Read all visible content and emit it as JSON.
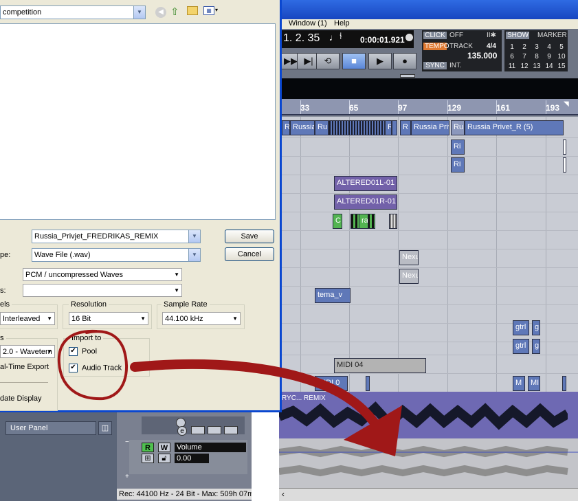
{
  "dialog": {
    "folder_value": "competition",
    "filename_label": "",
    "filename_value": "Russia_Privjet_FREDRIKAS_REMIX",
    "filetype_label": "pe:",
    "filetype_value": "Wave File (.wav)",
    "coding_value": "PCM / uncompressed Waves",
    "attr_label": "s:",
    "attr_value": "",
    "save_label": "Save",
    "cancel_label": "Cancel",
    "channels_label": "els",
    "channels_value": "Interleaved",
    "resolution_label": "Resolution",
    "resolution_value": "16 Bit",
    "samplerate_label": "Sample Rate",
    "samplerate_value": "44.100 kHz",
    "outputs_label": "s",
    "outputs_value": "2.0 - Wavetern",
    "realtime_label": "al-Time Export",
    "update_label": "date Display",
    "import_to_label": "Import to",
    "pool_label": "Pool",
    "audio_track_label": "Audio Track",
    "pool_checked": true,
    "audio_track_checked": true
  },
  "daw": {
    "menu_window": "Window (1)",
    "menu_help": "Help",
    "position_bars": "1. 2. 35",
    "position_time": "0:00:01.921",
    "click_label": "CLICK",
    "click_value": "OFF",
    "tempo_label": "TEMPO",
    "track_label": "TRACK",
    "signature": "4/4",
    "tempo_value": "135.000",
    "sync_label": "SYNC",
    "sync_value": "INT.",
    "show_label": "SHOW",
    "marker_label": "MARKER",
    "marker_numbers": [
      "1",
      "2",
      "3",
      "4",
      "5",
      "6",
      "7",
      "8",
      "9",
      "10",
      "11",
      "12",
      "13",
      "14",
      "15"
    ],
    "ruler": [
      "33",
      "65",
      "97",
      "129",
      "161",
      "193"
    ],
    "parts": {
      "p1": "R",
      "p2": "Russia",
      "p3": "Ru",
      "p4": "R",
      "p5": "R",
      "p6": "Ru",
      "p7": "Russia Priv",
      "p8": "Ru",
      "p9": "Russia Privet_R (5)",
      "p10": "Ri",
      "p11": "Ri",
      "altered_l": "ALTERED01L-01",
      "altered_r": "ALTERED01R-01",
      "g1": "C",
      "g2": "ra",
      "nexus1": "Nexu",
      "nexus2": "Nexu",
      "tema": "tema_v",
      "gtrl1": "gtrl",
      "g3": "g",
      "gtrl2": "gtrl",
      "g4": "g",
      "midi04": "MIDI 04",
      "midi_a": "MIDI 0",
      "midi_b": "M",
      "midi_c": "MII",
      "remix": "RYC... REMIX"
    },
    "inspector": {
      "user_panel": "User Panel",
      "r_button": "R",
      "w_button": "W",
      "automation_param": "Volume",
      "automation_value": "0.00"
    },
    "status_text": "Rec: 44100 Hz - 24 Bit - Max: 509h 07m"
  },
  "colors": {
    "annotation_red": "#a01818",
    "xp_blue": "#0a47d0",
    "part_blue": "#5f78b8",
    "part_purple": "#7261a9"
  }
}
